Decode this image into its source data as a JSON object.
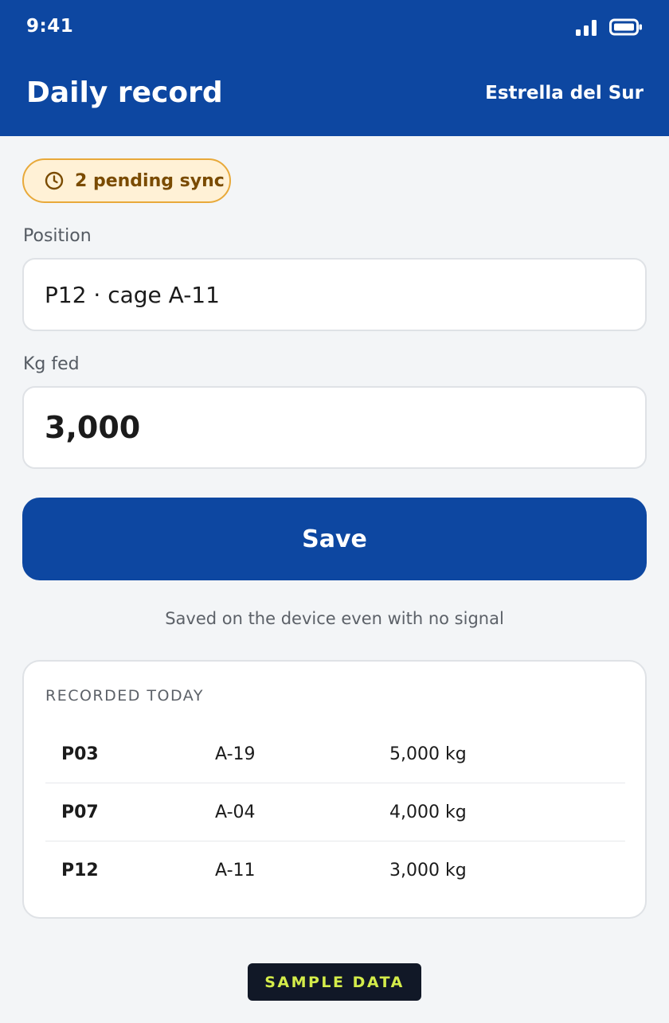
{
  "status_bar": {
    "time": "9:41",
    "signal_icon": "signal-bars-icon",
    "battery_icon": "battery-icon"
  },
  "header": {
    "title": "Daily record",
    "farm": "Estrella del Sur",
    "background": "#0d47a1"
  },
  "pending": {
    "icon": "clock-icon",
    "label": "2 pending sync"
  },
  "form": {
    "position_label": "Position",
    "position_value": "P12 · cage A-11",
    "kg_label": "Kg fed",
    "kg_value": "3,000",
    "save_label": "Save",
    "note": "Saved on the device even with no signal"
  },
  "today": {
    "title": "RECORDED TODAY",
    "rows": [
      {
        "position": "P03",
        "cage": "A-19",
        "kg": "5,000 kg"
      },
      {
        "position": "P07",
        "cage": "A-04",
        "kg": "4,000 kg"
      },
      {
        "position": "P12",
        "cage": "A-11",
        "kg": "3,000 kg"
      }
    ]
  },
  "footer": {
    "tag": "SAMPLE DATA"
  },
  "colors": {
    "accent": "#0d47a1",
    "warning_bg": "#fff1d6",
    "warning_border": "#e8a93a",
    "tag_text": "#d4ec4a"
  }
}
